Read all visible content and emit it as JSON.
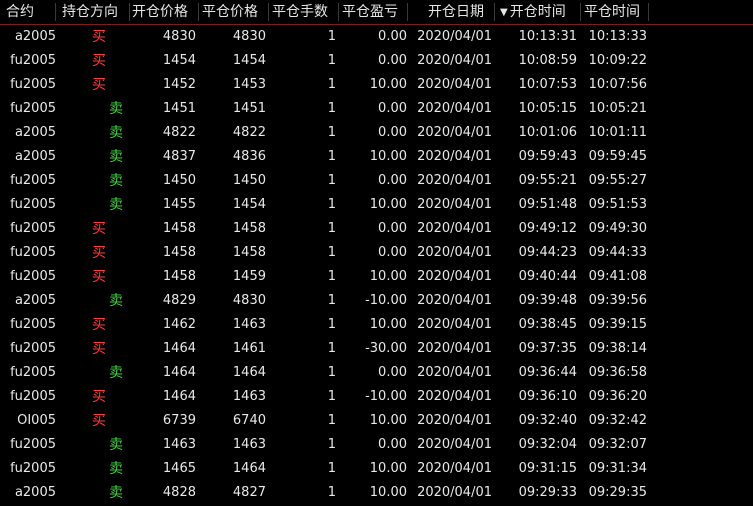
{
  "headers": {
    "contract": "合约",
    "direction": "持仓方向",
    "open_price": "开仓价格",
    "close_price": "平仓价格",
    "close_qty": "平仓手数",
    "close_pnl": "平仓盈亏",
    "open_date": "开仓日期",
    "open_time": "开仓时间",
    "close_time": "平仓时间"
  },
  "colors": {
    "buy": "#ff3b3b",
    "sell": "#3fd03f",
    "header_border": "#7a1f1f"
  },
  "sort_icon": "triangle-down-icon",
  "rows": [
    {
      "contract": "a2005",
      "direction": "买",
      "open_price": "4830",
      "close_price": "4830",
      "qty": "1",
      "pnl": "0.00",
      "date": "2020/04/01",
      "open_time": "10:13:31",
      "close_time": "10:13:33"
    },
    {
      "contract": "fu2005",
      "direction": "买",
      "open_price": "1454",
      "close_price": "1454",
      "qty": "1",
      "pnl": "0.00",
      "date": "2020/04/01",
      "open_time": "10:08:59",
      "close_time": "10:09:22"
    },
    {
      "contract": "fu2005",
      "direction": "买",
      "open_price": "1452",
      "close_price": "1453",
      "qty": "1",
      "pnl": "10.00",
      "date": "2020/04/01",
      "open_time": "10:07:53",
      "close_time": "10:07:56"
    },
    {
      "contract": "fu2005",
      "direction": "卖",
      "open_price": "1451",
      "close_price": "1451",
      "qty": "1",
      "pnl": "0.00",
      "date": "2020/04/01",
      "open_time": "10:05:15",
      "close_time": "10:05:21"
    },
    {
      "contract": "a2005",
      "direction": "卖",
      "open_price": "4822",
      "close_price": "4822",
      "qty": "1",
      "pnl": "0.00",
      "date": "2020/04/01",
      "open_time": "10:01:06",
      "close_time": "10:01:11"
    },
    {
      "contract": "a2005",
      "direction": "卖",
      "open_price": "4837",
      "close_price": "4836",
      "qty": "1",
      "pnl": "10.00",
      "date": "2020/04/01",
      "open_time": "09:59:43",
      "close_time": "09:59:45"
    },
    {
      "contract": "fu2005",
      "direction": "卖",
      "open_price": "1450",
      "close_price": "1450",
      "qty": "1",
      "pnl": "0.00",
      "date": "2020/04/01",
      "open_time": "09:55:21",
      "close_time": "09:55:27"
    },
    {
      "contract": "fu2005",
      "direction": "卖",
      "open_price": "1455",
      "close_price": "1454",
      "qty": "1",
      "pnl": "10.00",
      "date": "2020/04/01",
      "open_time": "09:51:48",
      "close_time": "09:51:53"
    },
    {
      "contract": "fu2005",
      "direction": "买",
      "open_price": "1458",
      "close_price": "1458",
      "qty": "1",
      "pnl": "0.00",
      "date": "2020/04/01",
      "open_time": "09:49:12",
      "close_time": "09:49:30"
    },
    {
      "contract": "fu2005",
      "direction": "买",
      "open_price": "1458",
      "close_price": "1458",
      "qty": "1",
      "pnl": "0.00",
      "date": "2020/04/01",
      "open_time": "09:44:23",
      "close_time": "09:44:33"
    },
    {
      "contract": "fu2005",
      "direction": "买",
      "open_price": "1458",
      "close_price": "1459",
      "qty": "1",
      "pnl": "10.00",
      "date": "2020/04/01",
      "open_time": "09:40:44",
      "close_time": "09:41:08"
    },
    {
      "contract": "a2005",
      "direction": "卖",
      "open_price": "4829",
      "close_price": "4830",
      "qty": "1",
      "pnl": "-10.00",
      "date": "2020/04/01",
      "open_time": "09:39:48",
      "close_time": "09:39:56"
    },
    {
      "contract": "fu2005",
      "direction": "买",
      "open_price": "1462",
      "close_price": "1463",
      "qty": "1",
      "pnl": "10.00",
      "date": "2020/04/01",
      "open_time": "09:38:45",
      "close_time": "09:39:15"
    },
    {
      "contract": "fu2005",
      "direction": "买",
      "open_price": "1464",
      "close_price": "1461",
      "qty": "1",
      "pnl": "-30.00",
      "date": "2020/04/01",
      "open_time": "09:37:35",
      "close_time": "09:38:14"
    },
    {
      "contract": "fu2005",
      "direction": "卖",
      "open_price": "1464",
      "close_price": "1464",
      "qty": "1",
      "pnl": "0.00",
      "date": "2020/04/01",
      "open_time": "09:36:44",
      "close_time": "09:36:58"
    },
    {
      "contract": "fu2005",
      "direction": "买",
      "open_price": "1464",
      "close_price": "1463",
      "qty": "1",
      "pnl": "-10.00",
      "date": "2020/04/01",
      "open_time": "09:36:10",
      "close_time": "09:36:20"
    },
    {
      "contract": "OI005",
      "direction": "买",
      "open_price": "6739",
      "close_price": "6740",
      "qty": "1",
      "pnl": "10.00",
      "date": "2020/04/01",
      "open_time": "09:32:40",
      "close_time": "09:32:42"
    },
    {
      "contract": "fu2005",
      "direction": "卖",
      "open_price": "1463",
      "close_price": "1463",
      "qty": "1",
      "pnl": "0.00",
      "date": "2020/04/01",
      "open_time": "09:32:04",
      "close_time": "09:32:07"
    },
    {
      "contract": "fu2005",
      "direction": "卖",
      "open_price": "1465",
      "close_price": "1464",
      "qty": "1",
      "pnl": "10.00",
      "date": "2020/04/01",
      "open_time": "09:31:15",
      "close_time": "09:31:34"
    },
    {
      "contract": "a2005",
      "direction": "卖",
      "open_price": "4828",
      "close_price": "4827",
      "qty": "1",
      "pnl": "10.00",
      "date": "2020/04/01",
      "open_time": "09:29:33",
      "close_time": "09:29:35"
    }
  ]
}
